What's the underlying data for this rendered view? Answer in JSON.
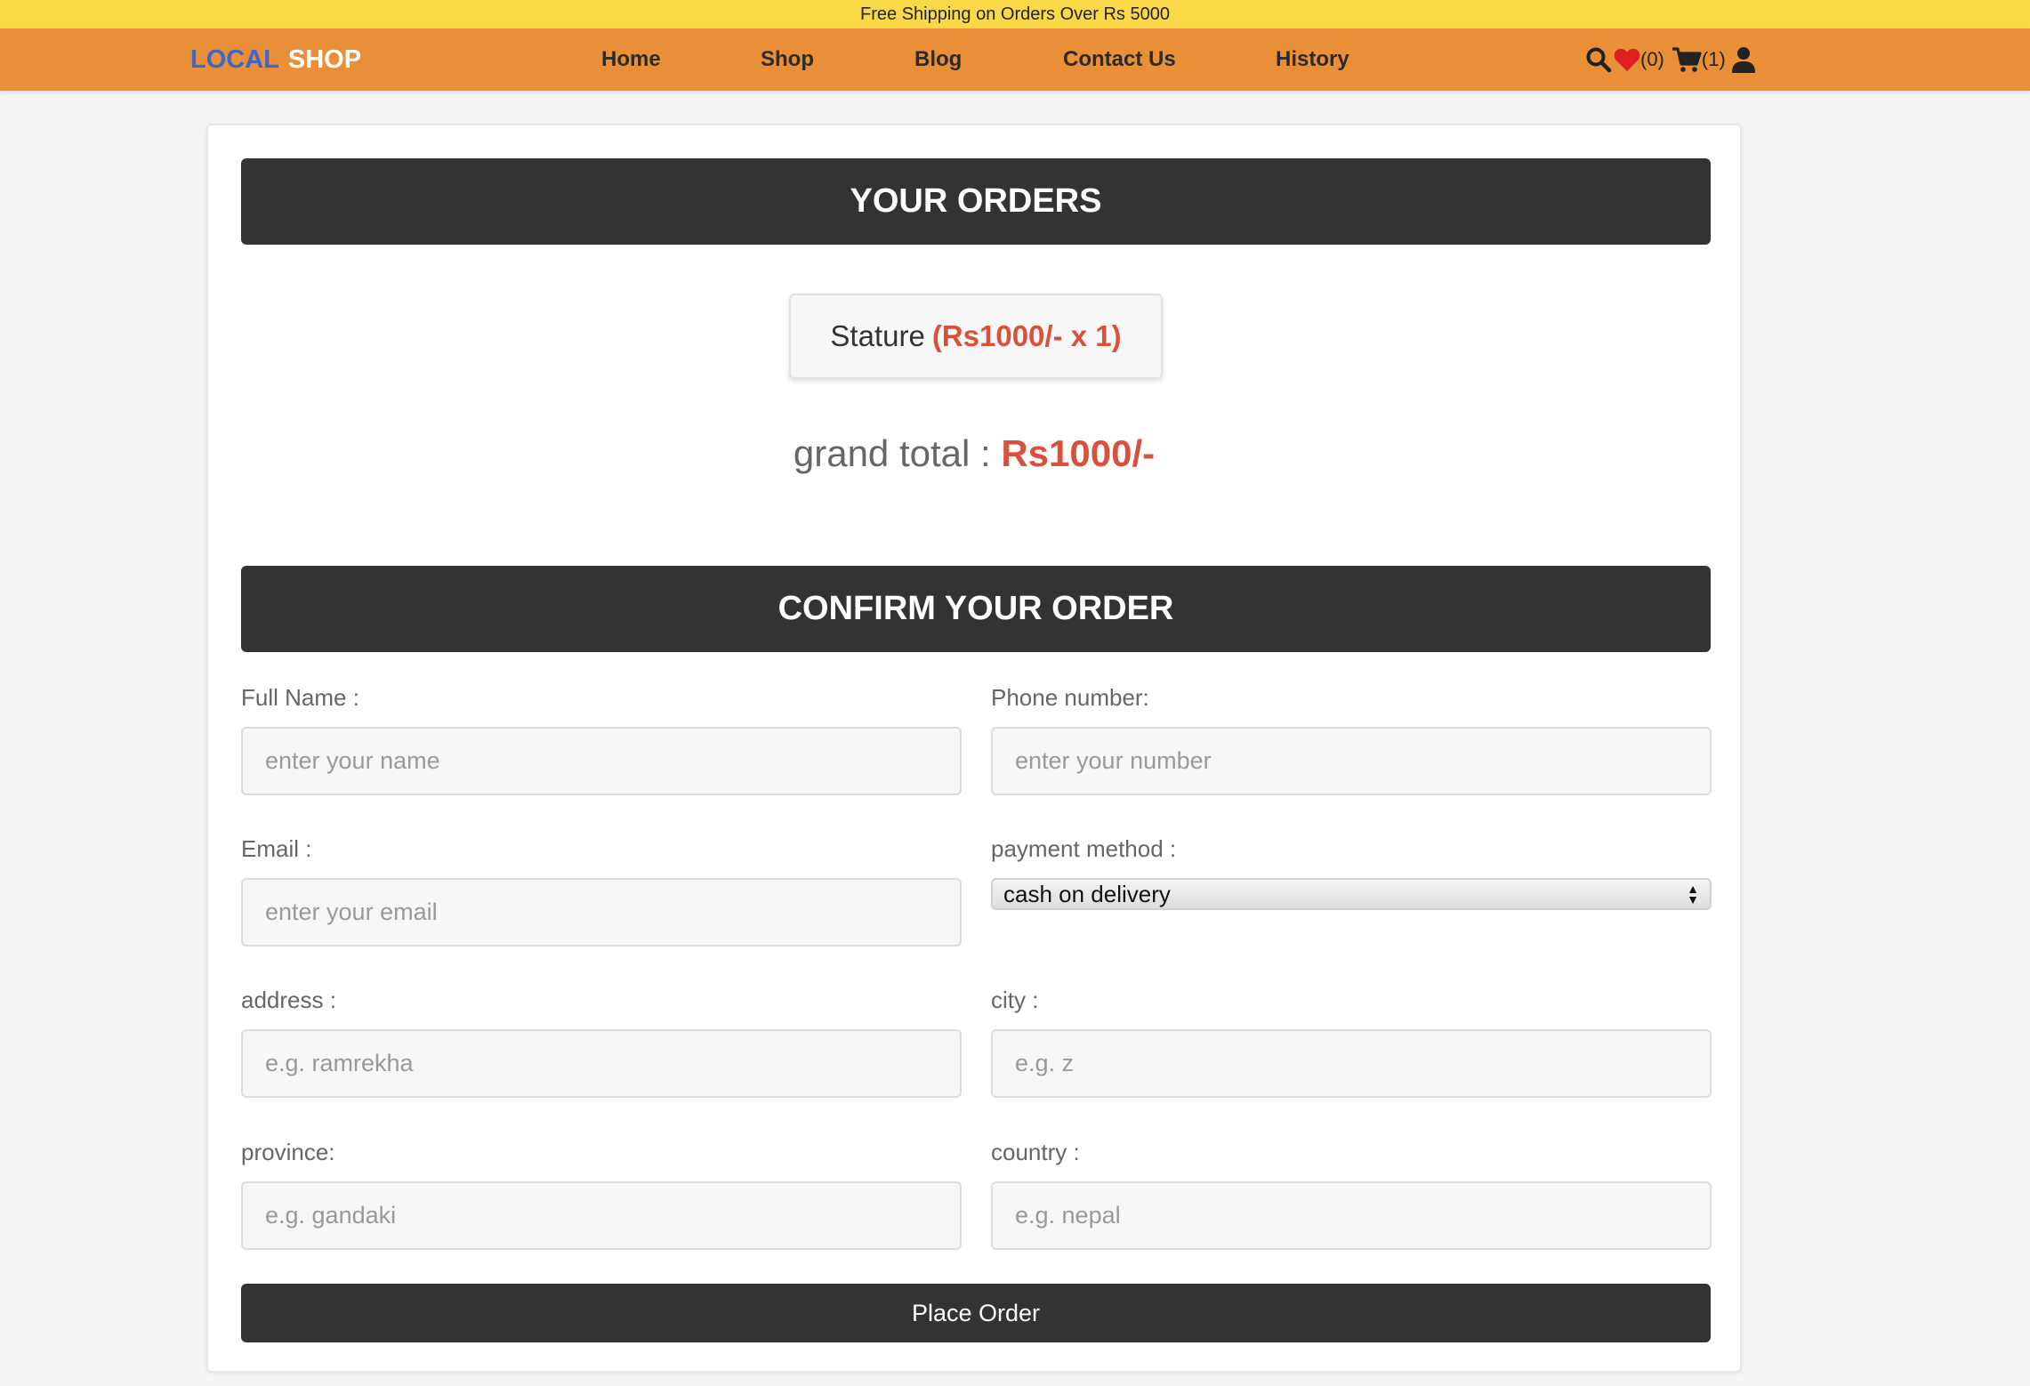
{
  "promo": {
    "text": "Free Shipping on Orders Over Rs 5000"
  },
  "brand": {
    "part1": "LOCAL",
    "part2": "SHOP",
    "part1_color": "#3e67c7",
    "part2_color": "#ffffff"
  },
  "nav": {
    "links": [
      "Home",
      "Shop",
      "Blog",
      "Contact Us",
      "History"
    ],
    "wishlist_count": "(0)",
    "cart_count": "(1)",
    "icons": [
      "search-icon",
      "heart-icon",
      "cart-icon",
      "user-icon"
    ]
  },
  "orders": {
    "title": "YOUR ORDERS",
    "item_name": "Stature",
    "item_price": "(Rs1000/- x 1)",
    "grand_total_label": "grand total :",
    "grand_total_value": "Rs1000/-"
  },
  "confirm": {
    "title": "CONFIRM YOUR ORDER",
    "fields": {
      "full_name": {
        "label": "Full Name :",
        "placeholder": "enter your name"
      },
      "phone": {
        "label": "Phone number:",
        "placeholder": "enter your number"
      },
      "email": {
        "label": "Email :",
        "placeholder": "enter your email"
      },
      "payment": {
        "label": "payment method :",
        "value": "cash on delivery"
      },
      "address": {
        "label": "address :",
        "placeholder": "e.g. ramrekha"
      },
      "city": {
        "label": "city :",
        "placeholder": "e.g. z"
      },
      "province": {
        "label": "province:",
        "placeholder": "e.g. gandaki"
      },
      "country": {
        "label": "country :",
        "placeholder": "e.g. nepal"
      }
    },
    "submit_label": "Place Order"
  },
  "colors": {
    "promo_bg": "#fad949",
    "nav_bg": "#e88f38",
    "header_bg": "#333333",
    "accent_red": "#d9503b",
    "heart": "#e02020"
  }
}
